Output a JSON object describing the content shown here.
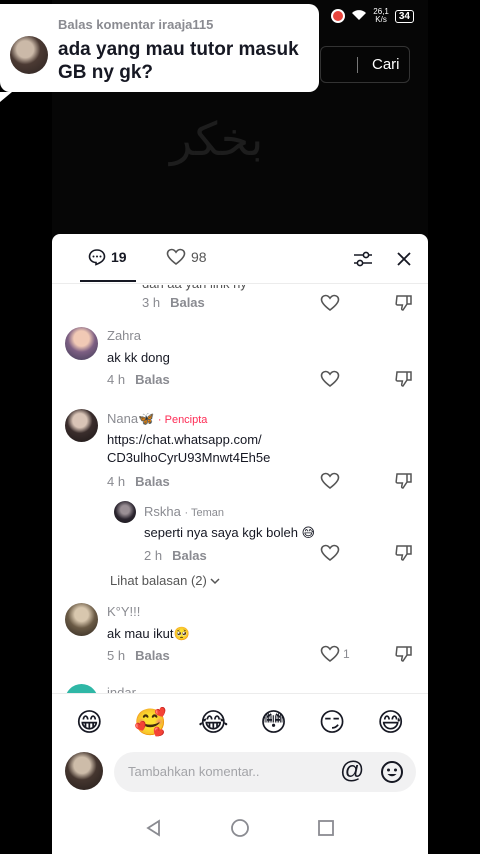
{
  "status_bar": {
    "speed_value": "26,1",
    "speed_unit": "K/s",
    "battery": "34"
  },
  "search": {
    "button_label": "Cari"
  },
  "reply_bubble": {
    "label": "Balas komentar iraaja115",
    "text": "ada yang mau tutor masuk GB ny gk?"
  },
  "sheet": {
    "comment_count": "19",
    "like_count": "98"
  },
  "comments": [
    {
      "text_partial": "dah aa yah link ny",
      "time": "3 h",
      "reply_label": "Balas"
    },
    {
      "name": "Zahra",
      "text": "ak kk dong",
      "time": "4 h",
      "reply_label": "Balas"
    },
    {
      "name": "Nana🦋",
      "tag": "· Pencipta",
      "text": "https://chat.whatsapp.com/\nCD3ulhoCyrU93Mnwt4Eh5e",
      "time": "4 h",
      "reply_label": "Balas"
    },
    {
      "name": "Rskha",
      "tag": "· Teman",
      "text": "seperti nya saya kgk boleh 😅",
      "time": "2 h",
      "reply_label": "Balas"
    },
    {
      "more_replies": "Lihat balasan (2)"
    },
    {
      "name": "K°Y!!!",
      "text": "ak mau ikut🥺",
      "time": "5 h",
      "reply_label": "Balas",
      "likes": "1"
    },
    {
      "name": "indar"
    }
  ],
  "emojis": [
    "😁",
    "🥰",
    "😂",
    "😳",
    "😏",
    "😅"
  ],
  "input": {
    "placeholder": "Tambahkan komentar..",
    "at_symbol": "@"
  },
  "colors": {
    "creator_tag": "#fe2c55",
    "sheet_bg": "#ffffff",
    "text_primary": "#161823",
    "text_secondary": "#8a8b91"
  }
}
